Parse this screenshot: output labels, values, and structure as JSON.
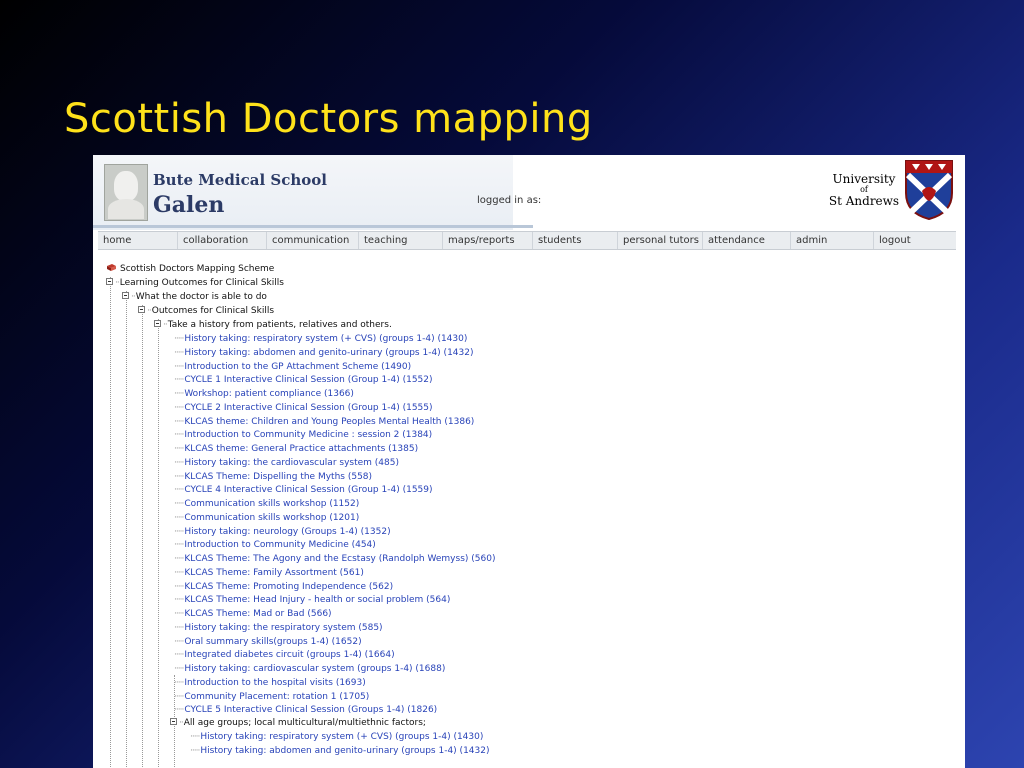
{
  "slide": {
    "title": "Scottish Doctors mapping"
  },
  "header": {
    "school_name": "Bute Medical School",
    "app_name": "Galen",
    "logged_in_label": "logged in as:",
    "university_line1": "University",
    "university_line2": "of",
    "university_line3": "St Andrews",
    "logo_icon": "bust-icon",
    "crest_icon": "university-crest-icon"
  },
  "nav": {
    "items": [
      {
        "label": "home"
      },
      {
        "label": "collaboration"
      },
      {
        "label": "communication"
      },
      {
        "label": "teaching"
      },
      {
        "label": "maps/reports"
      },
      {
        "label": "students"
      },
      {
        "label": "personal tutors"
      },
      {
        "label": "attendance"
      },
      {
        "label": "admin"
      },
      {
        "label": "logout"
      }
    ]
  },
  "tree": {
    "root": "Scottish Doctors Mapping Scheme",
    "level1": "Learning Outcomes for Clinical Skills",
    "level2": "What the doctor is able to do",
    "level3": "Outcomes for Clinical Skills",
    "group1": "Take a history from patients, relatives and others.",
    "group1_items": [
      "History taking: respiratory system (+ CVS) (groups 1-4) (1430)",
      "History taking: abdomen and genito-urinary (groups 1-4) (1432)",
      "Introduction to the GP Attachment Scheme (1490)",
      "CYCLE 1 Interactive Clinical Session (Group 1-4) (1552)",
      "Workshop: patient compliance (1366)",
      "CYCLE 2 Interactive Clinical Session (Group 1-4) (1555)",
      "KLCAS theme: Children and Young Peoples Mental Health (1386)",
      "Introduction to Community Medicine : session 2 (1384)",
      "KLCAS theme: General Practice attachments (1385)",
      "History taking: the cardiovascular system (485)",
      "KLCAS Theme: Dispelling the Myths (558)",
      "CYCLE 4 Interactive Clinical Session (Group 1-4) (1559)",
      "Communication skills workshop (1152)",
      "Communication skills workshop (1201)",
      "History taking: neurology (Groups 1-4) (1352)",
      "Introduction to Community Medicine (454)",
      "KLCAS Theme: The Agony and the Ecstasy (Randolph Wemyss) (560)",
      "KLCAS Theme: Family Assortment (561)",
      "KLCAS Theme: Promoting Independence (562)",
      "KLCAS Theme: Head Injury - health or social problem (564)",
      "KLCAS Theme: Mad or Bad (566)",
      "History taking: the respiratory system (585)",
      "Oral summary skills(groups 1-4) (1652)",
      "Integrated diabetes circuit (groups 1-4) (1664)",
      "History taking: cardiovascular system (groups 1-4) (1688)",
      "Introduction to the hospital visits (1693)",
      "Community Placement: rotation 1 (1705)",
      "CYCLE 5 Interactive Clinical Session (Groups 1-4) (1826)"
    ],
    "group2": "All age groups; local multicultural/multiethnic factors;",
    "group2_items": [
      "History taking: respiratory system (+ CVS) (groups 1-4) (1430)",
      "History taking: abdomen and genito-urinary (groups 1-4) (1432)"
    ]
  }
}
